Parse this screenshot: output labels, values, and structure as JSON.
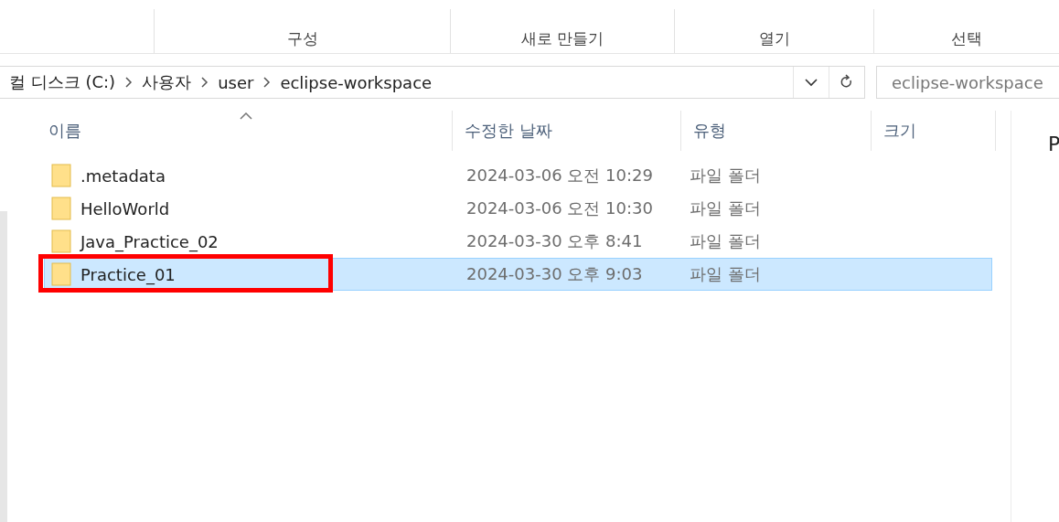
{
  "ribbon": {
    "groups": [
      "구성",
      "새로 만들기",
      "열기",
      "선택"
    ]
  },
  "address_bar": {
    "path": [
      "컬 디스크 (C:)",
      "사용자",
      "user",
      "eclipse-workspace"
    ]
  },
  "search": {
    "placeholder": "eclipse-workspace"
  },
  "columns": [
    "이름",
    "수정한 날짜",
    "유형",
    "크기"
  ],
  "files": [
    {
      "name": ".metadata",
      "modified": "2024-03-06 오전 10:29",
      "type": "파일 폴더",
      "selected": false,
      "highlighted": false
    },
    {
      "name": "HelloWorld",
      "modified": "2024-03-06 오전 10:30",
      "type": "파일 폴더",
      "selected": false,
      "highlighted": false
    },
    {
      "name": "Java_Practice_02",
      "modified": "2024-03-30 오후 8:41",
      "type": "파일 폴더",
      "selected": false,
      "highlighted": false
    },
    {
      "name": "Practice_01",
      "modified": "2024-03-30 오후 9:03",
      "type": "파일 폴더",
      "selected": true,
      "highlighted": true
    }
  ],
  "preview": {
    "title": "P"
  }
}
